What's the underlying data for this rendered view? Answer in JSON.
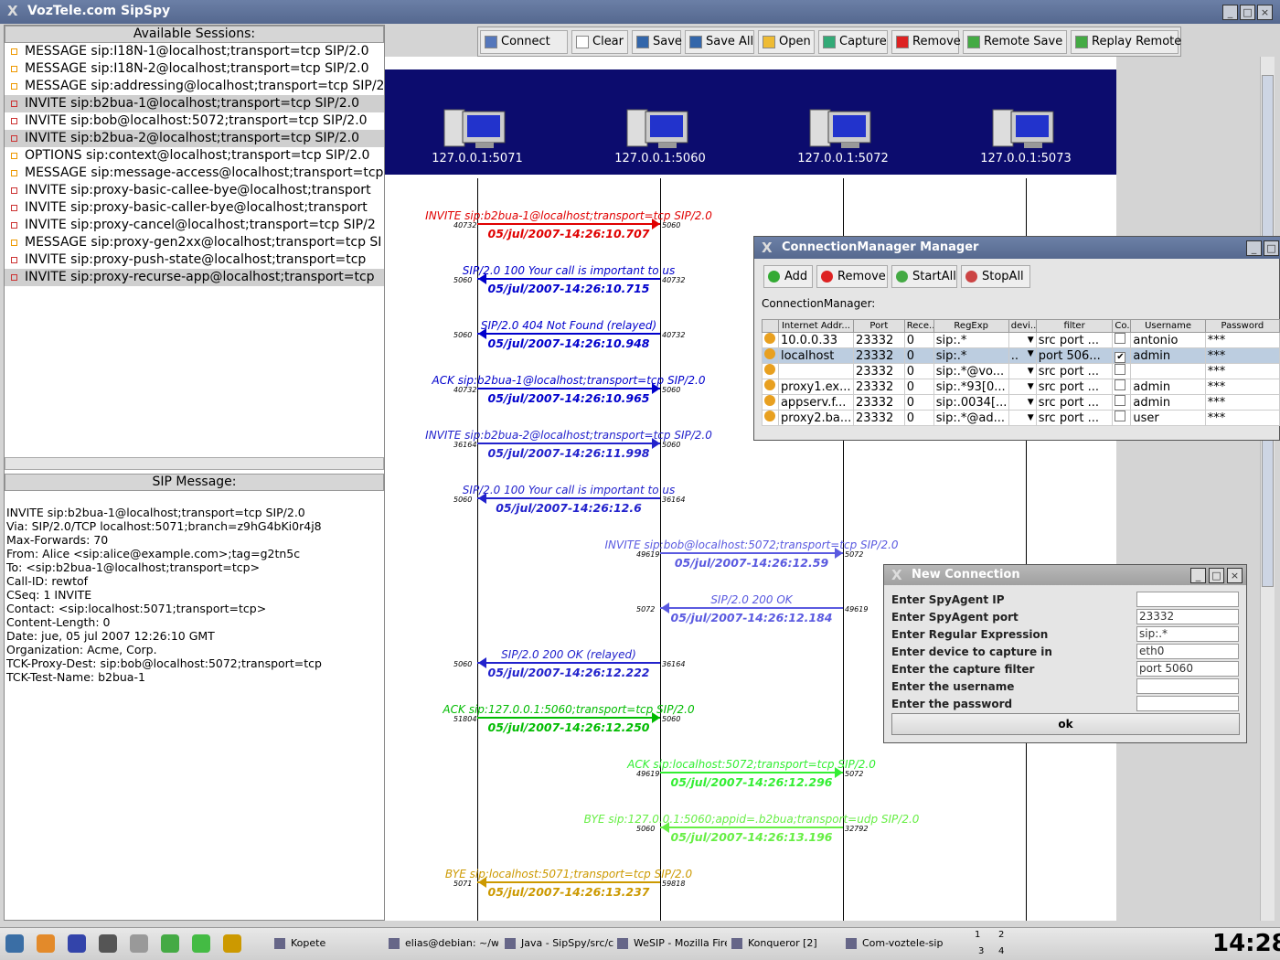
{
  "window": {
    "title": "VozTele.com SipSpy"
  },
  "sessions_panel": {
    "header": "Available Sessions:",
    "items": [
      {
        "label": "MESSAGE sip:I18N-1@localhost;transport=tcp SIP/2.0",
        "selected": false
      },
      {
        "label": "MESSAGE sip:I18N-2@localhost;transport=tcp SIP/2.0",
        "selected": false
      },
      {
        "label": "MESSAGE sip:addressing@localhost;transport=tcp SIP/2",
        "selected": false
      },
      {
        "label": "INVITE sip:b2bua-1@localhost;transport=tcp SIP/2.0",
        "selected": true
      },
      {
        "label": "INVITE sip:bob@localhost:5072;transport=tcp SIP/2.0",
        "selected": false
      },
      {
        "label": "INVITE sip:b2bua-2@localhost;transport=tcp SIP/2.0",
        "selected": true
      },
      {
        "label": "OPTIONS sip:context@localhost;transport=tcp SIP/2.0",
        "selected": false
      },
      {
        "label": "MESSAGE sip:message-access@localhost;transport=tcp",
        "selected": false
      },
      {
        "label": "INVITE sip:proxy-basic-callee-bye@localhost;transport",
        "selected": false
      },
      {
        "label": "INVITE sip:proxy-basic-caller-bye@localhost;transport",
        "selected": false
      },
      {
        "label": "INVITE sip:proxy-cancel@localhost;transport=tcp SIP/2",
        "selected": false
      },
      {
        "label": "MESSAGE sip:proxy-gen2xx@localhost;transport=tcp SI",
        "selected": false
      },
      {
        "label": "INVITE sip:proxy-push-state@localhost;transport=tcp",
        "selected": false
      },
      {
        "label": "INVITE sip:proxy-recurse-app@localhost;transport=tcp",
        "selected": true
      }
    ]
  },
  "sip_message": {
    "header": "SIP Message:",
    "lines": [
      "INVITE sip:b2bua-1@localhost;transport=tcp SIP/2.0",
      "Via: SIP/2.0/TCP localhost:5071;branch=z9hG4bKi0r4j8",
      "Max-Forwards: 70",
      "From: Alice <sip:alice@example.com>;tag=g2tn5c",
      "To: <sip:b2bua-1@localhost;transport=tcp>",
      "Call-ID: rewtof",
      "CSeq: 1 INVITE",
      "Contact: <sip:localhost:5071;transport=tcp>",
      "Content-Length: 0",
      "Date: jue, 05 jul 2007 12:26:10 GMT",
      "Organization: Acme, Corp.",
      "TCK-Proxy-Dest: sip:bob@localhost:5072;transport=tcp",
      "TCK-Test-Name: b2bua-1"
    ]
  },
  "toolbar": {
    "buttons": [
      "Connect",
      "Clear",
      "Save",
      "Save All",
      "Open",
      "Capture",
      "Remove",
      "Remote Save",
      "Replay Remote"
    ]
  },
  "hosts": [
    "127.0.0.1:5071",
    "127.0.0.1:5060",
    "127.0.0.1:5072",
    "127.0.0.1:5073"
  ],
  "messages": [
    {
      "text": "INVITE sip:b2bua-1@localhost;transport=tcp SIP/2.0",
      "time": "05/jul/2007-14:26:10.707",
      "from_port": "40732",
      "to_port": "5060",
      "from": 0,
      "to": 1,
      "color": "#e00000"
    },
    {
      "text": "SIP/2.0 100 Your call is important to us",
      "time": "05/jul/2007-14:26:10.715",
      "from_port": "40732",
      "to_port": "5060",
      "from": 1,
      "to": 0,
      "color": "#0000cc"
    },
    {
      "text": "SIP/2.0 404 Not Found (relayed)",
      "time": "05/jul/2007-14:26:10.948",
      "from_port": "40732",
      "to_port": "5060",
      "from": 1,
      "to": 0,
      "color": "#0000cc"
    },
    {
      "text": "ACK sip:b2bua-1@localhost;transport=tcp SIP/2.0",
      "time": "05/jul/2007-14:26:10.965",
      "from_port": "40732",
      "to_port": "5060",
      "from": 0,
      "to": 1,
      "color": "#0000cc"
    },
    {
      "text": "INVITE sip:b2bua-2@localhost;transport=tcp SIP/2.0",
      "time": "05/jul/2007-14:26:11.998",
      "from_port": "36164",
      "to_port": "5060",
      "from": 0,
      "to": 1,
      "color": "#2222cc"
    },
    {
      "text": "SIP/2.0 100 Your call is important to us",
      "time": "05/jul/2007-14:26:12.6",
      "from_port": "36164",
      "to_port": "5060",
      "from": 1,
      "to": 0,
      "color": "#2222cc"
    },
    {
      "text": "INVITE sip:bob@localhost:5072;transport=tcp SIP/2.0",
      "time": "05/jul/2007-14:26:12.59",
      "from_port": "49619",
      "to_port": "5072",
      "from": 1,
      "to": 2,
      "color": "#5a5ae0"
    },
    {
      "text": "SIP/2.0 200 OK",
      "time": "05/jul/2007-14:26:12.184",
      "from_port": "49619",
      "to_port": "5072",
      "from": 2,
      "to": 1,
      "color": "#5a5ae0"
    },
    {
      "text": "SIP/2.0 200 OK (relayed)",
      "time": "05/jul/2007-14:26:12.222",
      "from_port": "36164",
      "to_port": "5060",
      "from": 1,
      "to": 0,
      "color": "#2222cc"
    },
    {
      "text": "ACK sip:127.0.0.1:5060;transport=tcp SIP/2.0",
      "time": "05/jul/2007-14:26:12.250",
      "from_port": "51804",
      "to_port": "5060",
      "from": 0,
      "to": 1,
      "color": "#00bb00"
    },
    {
      "text": "ACK sip:localhost:5072;transport=tcp SIP/2.0",
      "time": "05/jul/2007-14:26:12.296",
      "from_port": "49619",
      "to_port": "5072",
      "from": 1,
      "to": 2,
      "color": "#33ee33"
    },
    {
      "text": "BYE sip:127.0.0.1:5060;appid=.b2bua;transport=udp SIP/2.0",
      "time": "05/jul/2007-14:26:13.196",
      "from_port": "32792",
      "to_port": "5060",
      "from": 2,
      "to": 1,
      "color": "#66ee44"
    },
    {
      "text": "BYE sip:localhost:5071;transport=tcp SIP/2.0",
      "time": "05/jul/2007-14:26:13.237",
      "from_port": "59818",
      "to_port": "5071",
      "from": 1,
      "to": 0,
      "color": "#cc9900"
    }
  ],
  "conn_manager": {
    "title": "ConnectionManager Manager",
    "buttons": [
      "Add",
      "Remove",
      "StartAll",
      "StopAll"
    ],
    "label": "ConnectionManager:",
    "columns": [
      "",
      "Internet Addr...",
      "Port",
      "Rece...",
      "RegExp",
      "devi...",
      "filter",
      "Co...",
      "Username",
      "Password"
    ],
    "rows": [
      [
        "10.0.0.33",
        "23332",
        "0",
        "sip:.*",
        "",
        "src port ...",
        false,
        "antonio",
        "***"
      ],
      [
        "localhost",
        "23332",
        "0",
        "sip:.*",
        "..",
        "port 506...",
        true,
        "admin",
        "***"
      ],
      [
        "",
        "23332",
        "0",
        "sip:.*@vo...",
        "",
        "src port ...",
        false,
        "",
        "***"
      ],
      [
        "proxy1.ex...",
        "23332",
        "0",
        "sip:.*93[0...",
        "",
        "src port ...",
        false,
        "admin",
        "***"
      ],
      [
        "appserv.f...",
        "23332",
        "0",
        "sip:.0034[...",
        "",
        "src port ...",
        false,
        "admin",
        "***"
      ],
      [
        "proxy2.ba...",
        "23332",
        "0",
        "sip:.*@ad...",
        "",
        "src port ...",
        false,
        "user",
        "***"
      ]
    ],
    "selected_row": 1
  },
  "new_connection": {
    "title": "New Connection",
    "fields": [
      {
        "label": "Enter SpyAgent IP",
        "value": ""
      },
      {
        "label": "Enter SpyAgent port",
        "value": "23332"
      },
      {
        "label": "Enter Regular Expression",
        "value": "sip:.*"
      },
      {
        "label": "Enter device to capture in",
        "value": "eth0"
      },
      {
        "label": "Enter the capture filter",
        "value": "port 5060"
      },
      {
        "label": "Enter the username",
        "value": ""
      },
      {
        "label": "Enter the password",
        "value": ""
      }
    ],
    "ok_label": "ok"
  },
  "taskbar": {
    "tasks": [
      "Kopete",
      "elias@debian: ~/wor",
      "Java - SipSpy/src/co",
      "WeSIP - Mozilla Firef",
      "Konqueror [2]",
      "Com-voztele-sip"
    ],
    "desktops": [
      "1",
      "2",
      "3",
      "4"
    ],
    "clock": "14:28"
  }
}
